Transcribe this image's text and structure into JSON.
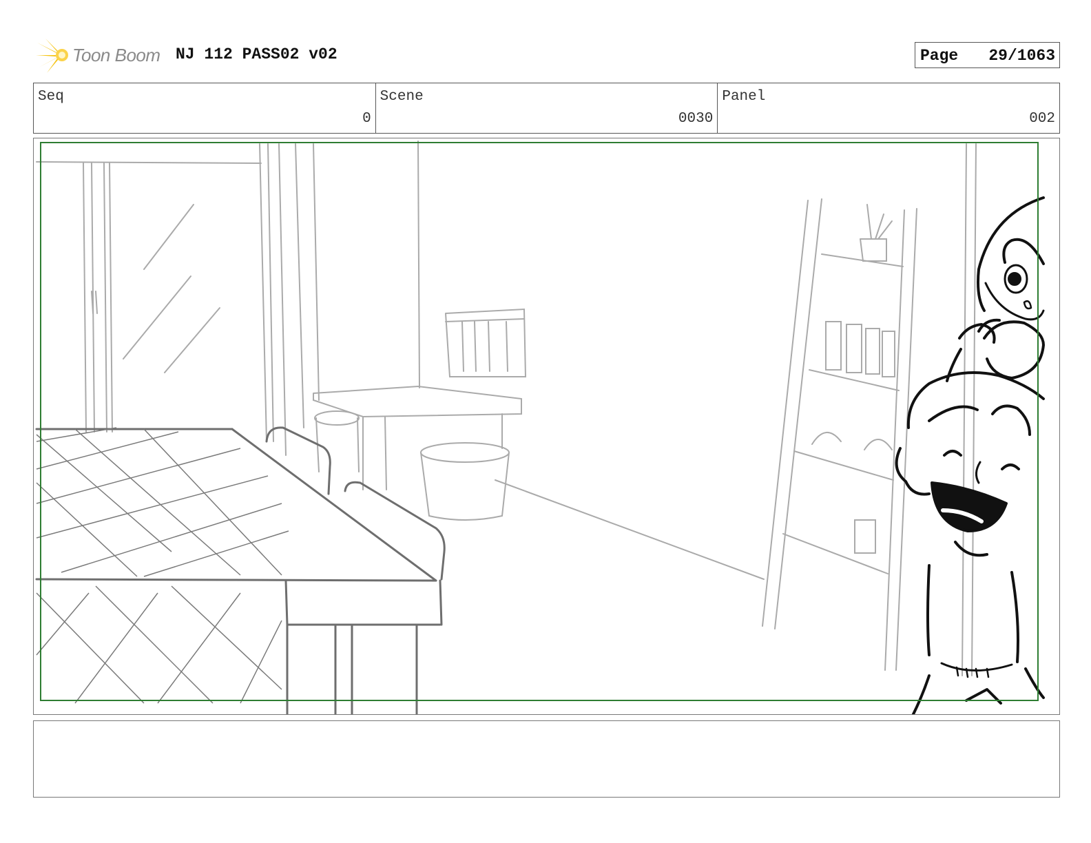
{
  "header": {
    "logo_text": "Toon Boom",
    "project_title": "NJ 112 PASS02 v02",
    "page_label": "Page",
    "page_value": "29/1063"
  },
  "info": {
    "seq_label": "Seq",
    "seq_value": "0",
    "scene_label": "Scene",
    "scene_value": "0030",
    "panel_label": "Panel",
    "panel_value": "002"
  },
  "panel": {
    "safe_frame_color": "#2e7d32",
    "sketch_color_background": "#a8a8a8",
    "sketch_color_foreground": "#6e6e6e",
    "sketch_color_character": "#111111",
    "characters": [
      "girl-with-goggles",
      "laughing-boy"
    ]
  },
  "notes": {
    "text": ""
  },
  "colors": {
    "logo_star": "#f5c518",
    "border": "#555555"
  }
}
